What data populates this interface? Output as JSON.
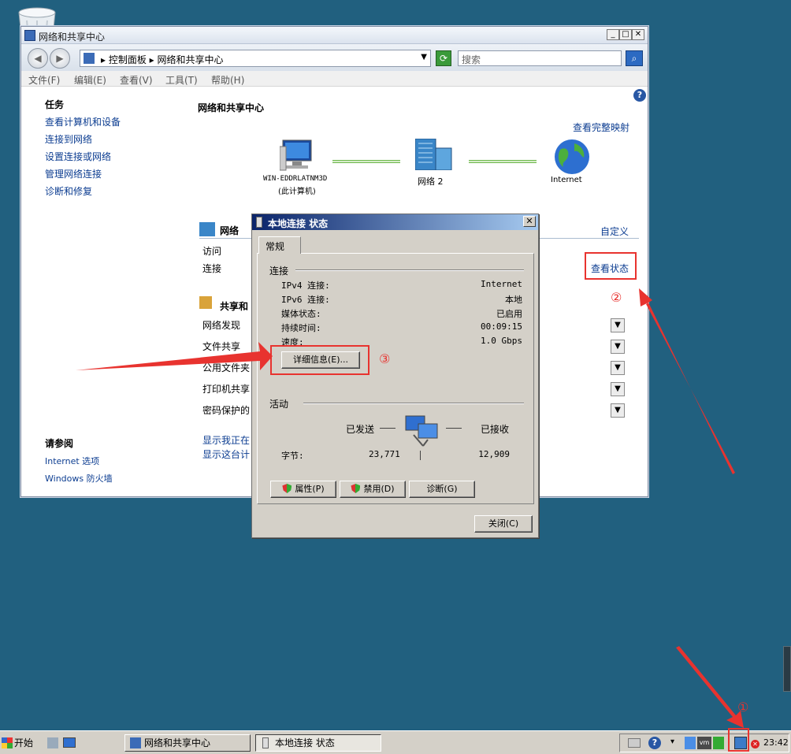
{
  "window": {
    "title": "网络和共享中心",
    "address_path": "▸ 控制面板 ▸ 网络和共享中心",
    "search_placeholder": "搜索",
    "menu": [
      "文件(F)",
      "编辑(E)",
      "查看(V)",
      "工具(T)",
      "帮助(H)"
    ]
  },
  "sidebar": {
    "tasks_heading": "任务",
    "tasks": [
      "查看计算机和设备",
      "连接到网络",
      "设置连接或网络",
      "管理网络连接",
      "诊断和修复"
    ],
    "see_also_heading": "请参阅",
    "see_also": [
      "Internet 选项",
      "Windows 防火墙"
    ]
  },
  "main": {
    "heading": "网络和共享中心",
    "view_full_map": "查看完整映射",
    "computer_name": "WIN-EDDRLATNM3D",
    "computer_sub": "(此计算机)",
    "network_label": "网络  2",
    "internet_label": "Internet",
    "network_section": "网络",
    "customize": "自定义",
    "access_label": "访问",
    "connection_label": "连接",
    "view_status": "查看状态",
    "sharing_section": "共享和",
    "sharing_items": [
      "网络发现",
      "文件共享",
      "公用文件夹",
      "打印机共享",
      "密码保护的"
    ],
    "bottom_links": [
      "显示我正在",
      "显示这台计"
    ]
  },
  "dialog": {
    "title": "本地连接 状态",
    "tab": "常规",
    "connection_group": "连接",
    "rows": [
      {
        "label": "IPv4 连接:",
        "value": "Internet"
      },
      {
        "label": "IPv6 连接:",
        "value": "本地"
      },
      {
        "label": "媒体状态:",
        "value": "已启用"
      },
      {
        "label": "持续时间:",
        "value": "00:09:15"
      },
      {
        "label": "速度:",
        "value": "1.0 Gbps"
      }
    ],
    "details_button": "详细信息(E)...",
    "activity_group": "活动",
    "sent_label": "已发送",
    "received_label": "已接收",
    "bytes_label": "字节:",
    "bytes_sent": "23,771",
    "bytes_received": "12,909",
    "properties_button": "属性(P)",
    "disable_button": "禁用(D)",
    "diagnose_button": "诊断(G)",
    "close_button": "关闭(C)"
  },
  "annotations": {
    "step1": "①",
    "step2": "②",
    "step3": "③"
  },
  "taskbar": {
    "start": "开始",
    "tasks": [
      "网络和共享中心",
      "本地连接 状态"
    ],
    "clock": "23:42"
  },
  "colors": {
    "desktop": "#21607f",
    "annotation_red": "#e8332f",
    "link_blue": "#0c3d91"
  }
}
